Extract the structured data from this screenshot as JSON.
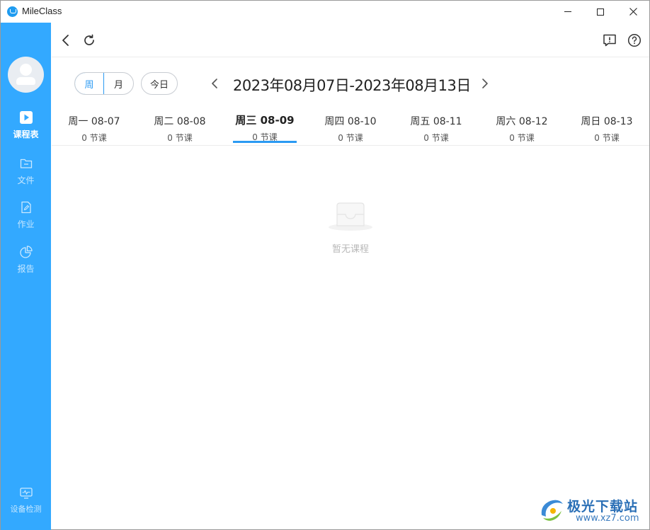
{
  "window": {
    "title": "MileClass",
    "controls": {
      "minimize": "minimize-icon",
      "maximize": "maximize-icon",
      "close": "close-icon"
    }
  },
  "sidebar": {
    "avatar": "avatar-icon",
    "items": [
      {
        "label": "课程表",
        "icon": "play-square-icon",
        "active": true
      },
      {
        "label": "文件",
        "icon": "folder-icon",
        "active": false
      },
      {
        "label": "作业",
        "icon": "edit-document-icon",
        "active": false
      },
      {
        "label": "报告",
        "icon": "pie-chart-icon",
        "active": false
      }
    ],
    "bottom_item": {
      "label": "设备检测",
      "icon": "monitor-pulse-icon"
    }
  },
  "toolbar": {
    "back": "back-arrow-icon",
    "refresh": "refresh-icon",
    "feedback": "feedback-icon",
    "help": "help-icon"
  },
  "view": {
    "week_label": "周",
    "month_label": "月",
    "today_label": "今日",
    "selected": "周",
    "range_text": "2023年08月07日-2023年08月13日"
  },
  "days": [
    {
      "name": "周一  08-07",
      "count": "0 节课",
      "active": false
    },
    {
      "name": "周二  08-08",
      "count": "0 节课",
      "active": false
    },
    {
      "name": "周三  08-09",
      "count": "0 节课",
      "active": true
    },
    {
      "name": "周四  08-10",
      "count": "0 节课",
      "active": false
    },
    {
      "name": "周五  08-11",
      "count": "0 节课",
      "active": false
    },
    {
      "name": "周六  08-12",
      "count": "0 节课",
      "active": false
    },
    {
      "name": "周日  08-13",
      "count": "0 节课",
      "active": false
    }
  ],
  "empty_state": {
    "text": "暂无课程",
    "icon": "empty-inbox-icon"
  },
  "watermark": {
    "text": "极光下载站",
    "url": "www.xz7.com"
  },
  "colors": {
    "accent": "#2b9af3",
    "sidebar": "#33a9ff",
    "empty_text": "#b8b8b8"
  }
}
